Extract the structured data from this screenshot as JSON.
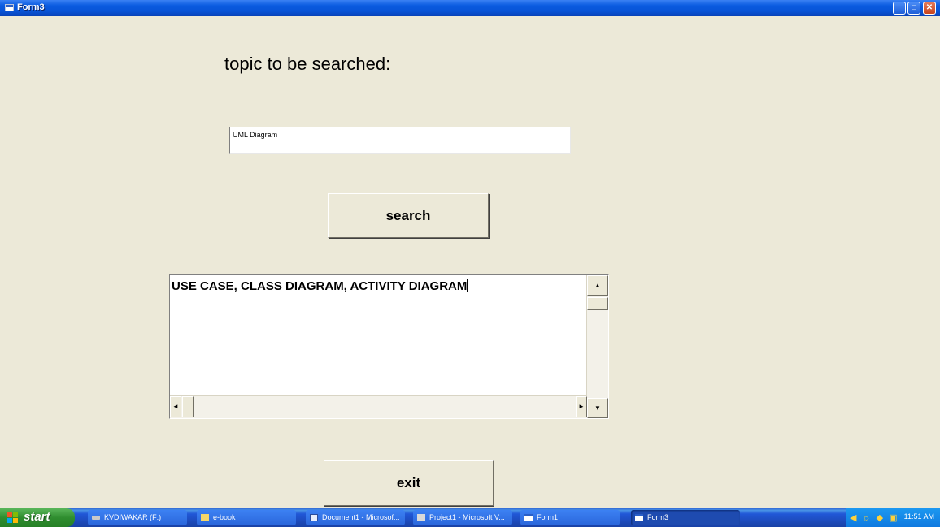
{
  "window": {
    "title": "Form3",
    "controls": {
      "minimize": "_",
      "maximize": "□",
      "close": "✕"
    }
  },
  "form": {
    "topic_label": "topic to be searched:",
    "topic_input_value": "UML Diagram",
    "search_button": "search",
    "result_text": "USE CASE, CLASS DIAGRAM, ACTIVITY DIAGRAM",
    "exit_button": "exit",
    "scroll_arrows": {
      "up": "▲",
      "down": "▼",
      "left": "◄",
      "right": "►"
    }
  },
  "taskbar": {
    "start_label": "start",
    "tasks": [
      {
        "label": "KVDIWAKAR (F:)",
        "icon": "drive-icon",
        "active": false
      },
      {
        "label": "e-book",
        "icon": "folder-icon",
        "active": false
      },
      {
        "label": "Document1 - Microsof...",
        "icon": "word-document-icon",
        "active": false
      },
      {
        "label": "Project1 - Microsoft V...",
        "icon": "visual-basic-icon",
        "active": false
      },
      {
        "label": "Form1",
        "icon": "form-window-icon",
        "active": false
      },
      {
        "label": "Form3",
        "icon": "form-window-icon",
        "active": true
      }
    ],
    "clock": "11:51 AM"
  },
  "colors": {
    "form_background": "#ECE9D8",
    "titlebar_blue": "#0A5BE0",
    "taskbar_blue": "#245EDC",
    "start_green": "#3C9A3C"
  }
}
